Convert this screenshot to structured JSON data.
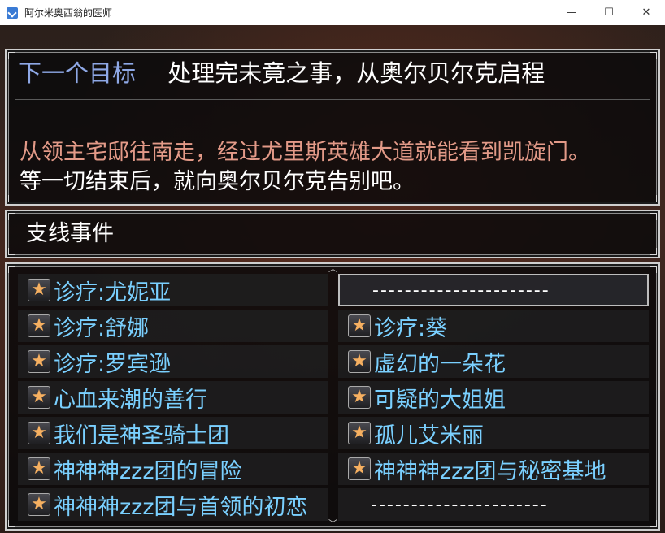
{
  "window": {
    "title": "阿尔米奥西翁的医师",
    "minimize_glyph": "—",
    "maximize_glyph": "☐",
    "close_glyph": "✕"
  },
  "goal": {
    "label": "下一个目标",
    "value": "处理完未竟之事，从奥尔贝尔克启程",
    "line1": "从领主宅邸往南走，经过尤里斯英雄大道就能看到凯旋门。",
    "line2": "等一切结束后，就向奥尔贝尔克告别吧。"
  },
  "side_events": {
    "title": "支线事件"
  },
  "icons": {
    "star": "★"
  },
  "quests": [
    {
      "label": "诊疗:尤妮亚"
    },
    {
      "label": "----------------------"
    },
    {
      "label": "诊疗:舒娜"
    },
    {
      "label": "诊疗:葵"
    },
    {
      "label": "诊疗:罗宾逊"
    },
    {
      "label": "虚幻的一朵花"
    },
    {
      "label": "心血来潮的善行"
    },
    {
      "label": "可疑的大姐姐"
    },
    {
      "label": "我们是神圣骑士团"
    },
    {
      "label": "孤儿艾米丽"
    },
    {
      "label": "神神神zzz团的冒险"
    },
    {
      "label": "神神神zzz团与秘密基地"
    },
    {
      "label": "神神神zzz团与首领的初恋"
    },
    {
      "label": "----------------------"
    }
  ],
  "colors": {
    "goal_label": "#8ea8e6",
    "highlight_text": "#e39a88",
    "quest_text": "#7ad0ff",
    "star": "#f6b061"
  }
}
